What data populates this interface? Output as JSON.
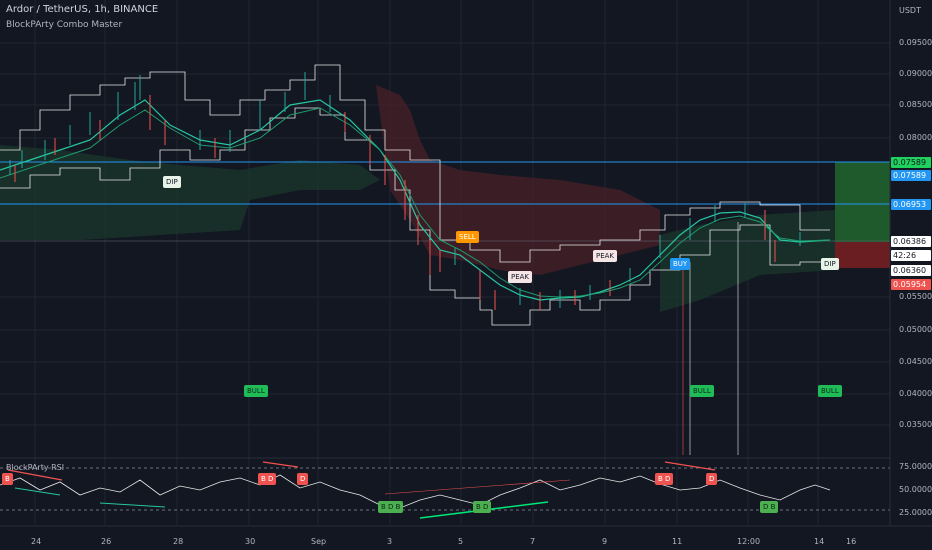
{
  "header": {
    "title": "Ardor / TetherUS, 1h, BINANCE",
    "indicator": "BlockPArty Combo Master",
    "currency_badge": "USDT"
  },
  "price_axis": [
    "0.09500",
    "0.09000",
    "0.08500",
    "0.08000",
    "0.06953",
    "0.05500",
    "0.05000",
    "0.04500",
    "0.04000",
    "0.03500"
  ],
  "price_tags": {
    "level_green": "0.07589",
    "level_blue": "0.07589",
    "level_blue2": "0.06953",
    "current": "0.06386",
    "countdown": "42:26",
    "entry": "0.06360",
    "stop": "0.05954"
  },
  "rsi_axis": [
    "75.00000",
    "50.00000",
    "25.00000"
  ],
  "rsi_title": "BlockPArty RSI",
  "time_axis": [
    "24",
    "26",
    "28",
    "30",
    "Sep",
    "3",
    "5",
    "7",
    "9",
    "11",
    "12:00",
    "14",
    "16"
  ],
  "signals": {
    "dip1": "DIP",
    "dip2": "DIP",
    "sell": "SELL",
    "peak1": "PEAK",
    "peak2": "PEAK",
    "buy": "BUY",
    "bull1": "BULL",
    "bull2": "BULL",
    "bull3": "BULL"
  },
  "rsi_tags": {
    "bear1": "B",
    "bear2": "B D",
    "bear3": "D",
    "bear4": "B D",
    "bear5": "D",
    "bull1": "B D B",
    "bull2": "B D",
    "bull3": "D B"
  },
  "colors": {
    "background": "#131722",
    "up": "#26a69a",
    "down": "#ef5350",
    "blue_level": "#2196f3",
    "green_label": "#00e676",
    "bull_tag": "#1fbc58"
  }
}
